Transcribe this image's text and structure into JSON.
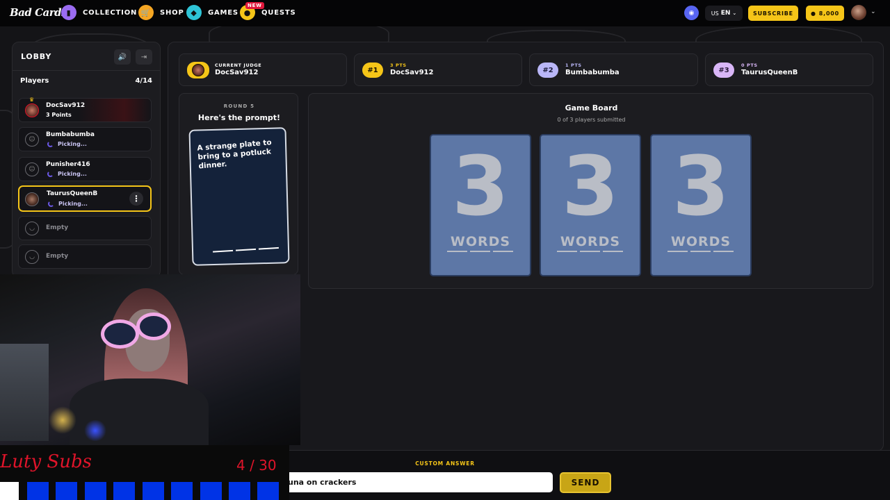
{
  "nav": {
    "logo": "Bad Cards",
    "items": [
      {
        "label": "COLLECTION",
        "icon": "card-icon",
        "color": "#9b6cf2"
      },
      {
        "label": "SHOP",
        "icon": "cart-icon",
        "color": "#f5a623"
      },
      {
        "label": "GAMES",
        "icon": "games-icon",
        "color": "#2ec4d6"
      },
      {
        "label": "QUESTS",
        "icon": "quest-icon",
        "color": "#f5c518",
        "badge": "NEW"
      }
    ],
    "region": "US",
    "language": "EN",
    "subscribe": "SUBSCRIBE",
    "coins": "8,000"
  },
  "lobby": {
    "title": "LOBBY",
    "players_label": "Players",
    "players_count": "4/14",
    "players": [
      {
        "name": "DocSav912",
        "status": "3 Points",
        "role": "judge"
      },
      {
        "name": "Bumbabumba",
        "status": "Picking..."
      },
      {
        "name": "Punisher416",
        "status": "Picking..."
      },
      {
        "name": "TaurusQueenB",
        "status": "Picking...",
        "self": true
      }
    ],
    "empty_label": "Empty"
  },
  "scores": {
    "judge": {
      "label": "CURRENT JUDGE",
      "name": "DocSav912"
    },
    "ranks": [
      {
        "rank": "#1",
        "pts": "3 PTS",
        "name": "DocSav912",
        "color": "#f5c518",
        "text_color": "#1a1200"
      },
      {
        "rank": "#2",
        "pts": "1 PTS",
        "name": "Bumbabumba",
        "color": "#b9b6f7",
        "text_color": "#1a1a3a"
      },
      {
        "rank": "#3",
        "pts": "0 PTS",
        "name": "TaurusQueenB",
        "color": "#d9b6f7",
        "text_color": "#2a1a3a"
      }
    ]
  },
  "prompt": {
    "round": "ROUND 5",
    "heading": "Here's the prompt!",
    "text": "A strange plate to bring to a potluck dinner."
  },
  "board": {
    "title": "Game Board",
    "subtitle": "0 of 3 players submitted",
    "cards": [
      {
        "number": "3",
        "word": "WORDS"
      },
      {
        "number": "3",
        "word": "WORDS"
      },
      {
        "number": "3",
        "word": "WORDS"
      }
    ]
  },
  "answer": {
    "label": "CUSTOM ANSWER",
    "value": "una on crackers",
    "send": "SEND"
  },
  "subs_goal": {
    "label": "Luty Subs",
    "count": "4 / 30",
    "current": 4,
    "goal": 30
  }
}
